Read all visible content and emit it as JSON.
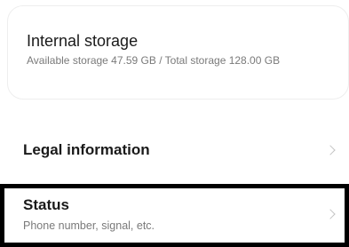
{
  "storage": {
    "title": "Internal storage",
    "detail": "Available storage  47.59 GB / Total storage  128.00 GB"
  },
  "legal": {
    "label": "Legal information"
  },
  "status": {
    "label": "Status",
    "subtitle": "Phone number, signal, etc."
  },
  "icons": {
    "chevron": "chevron-right-icon"
  }
}
